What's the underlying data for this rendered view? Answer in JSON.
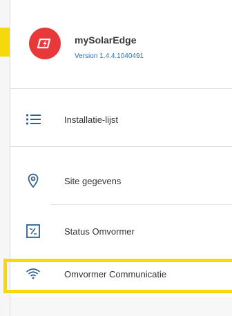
{
  "app": {
    "name": "mySolarEdge",
    "version": "Version 1.4.4.1040491",
    "logo_icon": "lightning-bolt-icon",
    "logo_color": "#e8393a"
  },
  "nav": {
    "items": [
      {
        "label": "Installatie-lijst",
        "icon": "list-icon"
      },
      {
        "label": "Site gegevens",
        "icon": "location-pin-icon"
      },
      {
        "label": "Status Omvormer",
        "icon": "inverter-icon"
      },
      {
        "label": "Omvormer Communicatie",
        "icon": "wifi-icon"
      }
    ]
  },
  "colors": {
    "highlight": "#f5d90a",
    "version_text": "#2f6fb5",
    "icon": "#2e5f8f"
  }
}
